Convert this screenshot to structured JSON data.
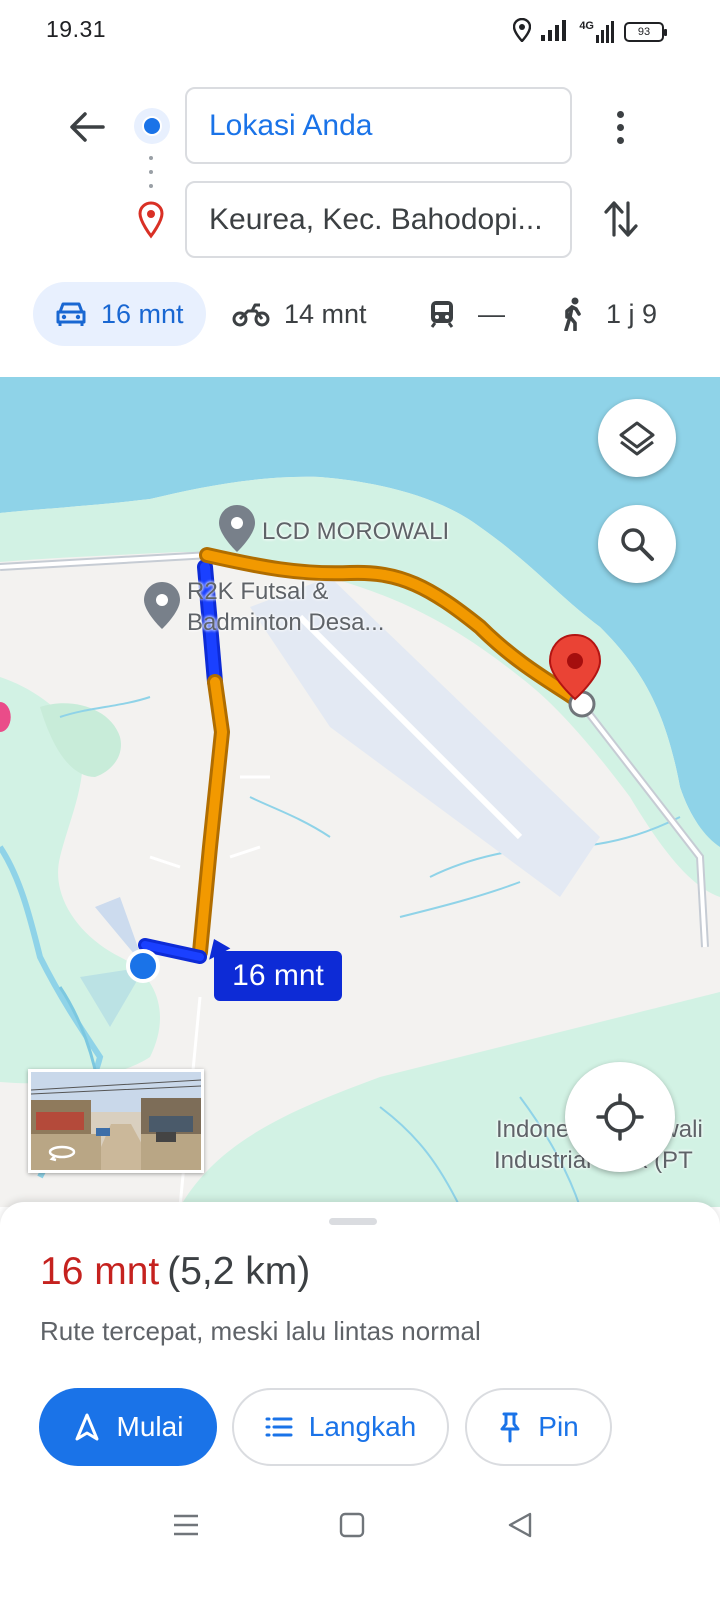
{
  "status_bar": {
    "time": "19.31",
    "network": "4G",
    "battery": "93"
  },
  "route_header": {
    "origin": "Lokasi Anda",
    "destination": "Keurea, Kec. Bahodopi..."
  },
  "travel_modes": [
    {
      "mode": "car",
      "label": "16 mnt",
      "icon": "car-icon",
      "active": true
    },
    {
      "mode": "motorcycle",
      "label": "14 mnt",
      "icon": "motorcycle-icon",
      "active": false
    },
    {
      "mode": "transit",
      "label": "—",
      "icon": "train-icon",
      "active": false
    },
    {
      "mode": "walk",
      "label": "1 j 9",
      "icon": "walking-icon",
      "active": false
    }
  ],
  "map": {
    "places": [
      "LCD MOROWALI",
      "R2K Futsal &",
      "Badminton Desa...",
      "Indonesia Morowali",
      "Industrial Park (PT"
    ],
    "route_callout": "16 mnt"
  },
  "summary": {
    "duration": "16 mnt",
    "distance": "(5,2 km)",
    "description": "Rute tercepat, meski lalu lintas normal"
  },
  "actions": {
    "start": "Mulai",
    "steps": "Langkah",
    "pin": "Pin"
  },
  "colors": {
    "accent": "#1a73e8",
    "duration": "#c5221f",
    "route_traffic": "#f29900",
    "route_clear": "#0d2bd6",
    "water": "#8fd3e8",
    "park": "#d2f2e4"
  }
}
